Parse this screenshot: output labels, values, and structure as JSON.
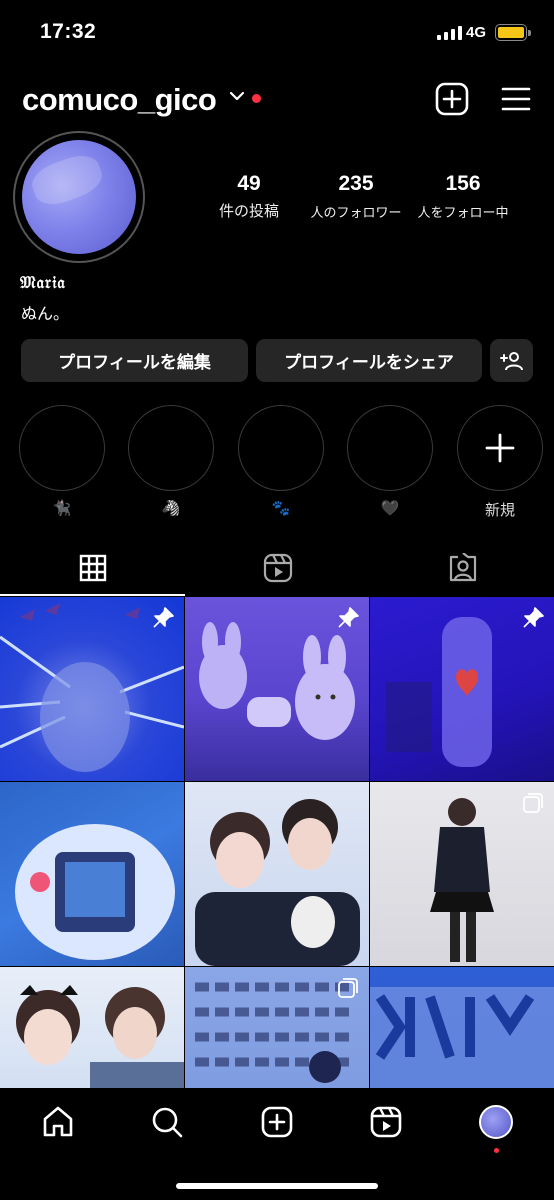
{
  "status_bar": {
    "time": "17:32",
    "network": "4G",
    "battery_color": "#f5c518"
  },
  "header": {
    "username": "comuco_gico",
    "notification_dot_color": "#ff3040",
    "icons": [
      "chevron-down-icon",
      "new-post-icon",
      "menu-icon"
    ]
  },
  "profile": {
    "display_name": "𝔐𝔞𝔯𝔦𝔞",
    "bio": "ぬん。",
    "stats": [
      {
        "value": "49",
        "label": "件の投稿"
      },
      {
        "value": "235",
        "label": "人のフォロワー"
      },
      {
        "value": "156",
        "label": "人をフォロー中"
      }
    ]
  },
  "actions": {
    "edit_profile": "プロフィールを編集",
    "share_profile": "プロフィールをシェア",
    "discover_people_icon": "add-person-icon"
  },
  "highlights": [
    {
      "label": "🐈‍⬛"
    },
    {
      "label": "🦓"
    },
    {
      "label": "🐾"
    },
    {
      "label": "🖤"
    },
    {
      "label": "新規",
      "is_new": true
    }
  ],
  "tabs": [
    {
      "name": "grid",
      "icon": "grid-icon",
      "active": true
    },
    {
      "name": "reels",
      "icon": "reels-icon",
      "active": false
    },
    {
      "name": "tagged",
      "icon": "tagged-icon",
      "active": false
    }
  ],
  "posts": [
    {
      "pinned": true,
      "multi": false
    },
    {
      "pinned": true,
      "multi": false
    },
    {
      "pinned": true,
      "multi": false
    },
    {
      "pinned": false,
      "multi": false
    },
    {
      "pinned": false,
      "multi": false
    },
    {
      "pinned": false,
      "multi": true
    },
    {
      "pinned": false,
      "multi": false
    },
    {
      "pinned": false,
      "multi": true
    },
    {
      "pinned": false,
      "multi": false
    }
  ],
  "bottom_nav": {
    "items": [
      "home-icon",
      "search-icon",
      "create-icon",
      "reels-icon",
      "profile-avatar"
    ],
    "active_dot_color": "#ff3040"
  }
}
